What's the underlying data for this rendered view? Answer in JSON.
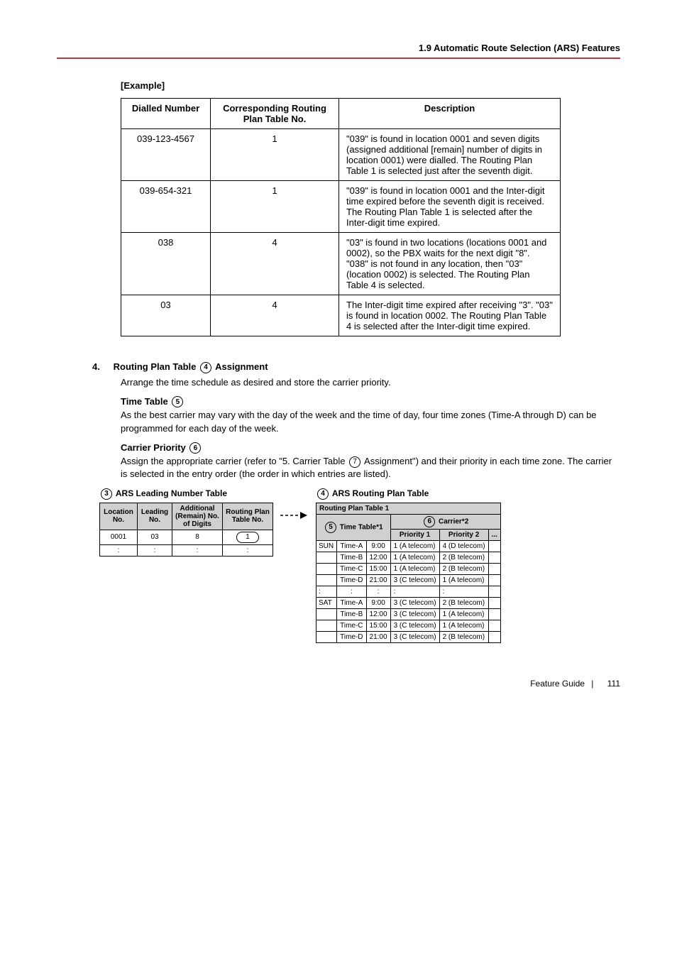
{
  "header": "1.9 Automatic Route Selection (ARS) Features",
  "example_label": "[Example]",
  "example_table": {
    "headers": [
      "Dialled Number",
      "Corresponding Routing Plan Table No.",
      "Description"
    ],
    "rows": [
      {
        "c1": "039-123-4567",
        "c2": "1",
        "c3": "\"039\" is found in location 0001 and seven digits (assigned additional [remain] number of digits in location 0001) were dialled. The Routing Plan Table 1 is selected just after the seventh digit."
      },
      {
        "c1": "039-654-321",
        "c2": "1",
        "c3": "\"039\" is found in location 0001 and the Inter-digit time expired before the seventh digit is received. The Routing Plan Table 1 is selected after the Inter-digit time expired."
      },
      {
        "c1": "038",
        "c2": "4",
        "c3": "\"03\" is found in two locations (locations 0001 and 0002), so the PBX waits for the next digit \"8\". \"038\" is not found in any location, then \"03\" (location 0002) is selected. The Routing Plan Table 4 is selected."
      },
      {
        "c1": "03",
        "c2": "4",
        "c3": "The Inter-digit time expired after receiving \"3\". \"03\" is found in location 0002. The Routing Plan Table 4 is selected after the Inter-digit time expired."
      }
    ]
  },
  "step4": {
    "num": "4.",
    "title_a": "Routing Plan Table",
    "title_b": "Assignment",
    "circle4": "4",
    "para1": "Arrange the time schedule as desired and store the carrier priority.",
    "sub1_a": "Time Table",
    "circle5": "5",
    "para2": "As the best carrier may vary with the day of the week and the time of day, four time zones (Time-A through D) can be programmed for each day of the week.",
    "sub2_a": "Carrier Priority",
    "circle6": "6",
    "para3_a": "Assign the appropriate carrier (refer to \"5. Carrier Table",
    "circle7": "7",
    "para3_b": "Assignment\") and their priority in each time zone. The carrier is selected in the entry order (the order in which entries are listed)."
  },
  "leading_table": {
    "circle3": "3",
    "title": "ARS Leading Number Table",
    "headers": [
      "Location No.",
      "Leading No.",
      "Additional (Remain) No. of Digits",
      "Routing Plan Table No."
    ],
    "row": {
      "c1": "0001",
      "c2": "03",
      "c3": "8",
      "c4": "1"
    },
    "dots": ":"
  },
  "routing_plan": {
    "circle4": "4",
    "title": "ARS Routing Plan Table",
    "subtitle": "Routing Plan Table 1",
    "time_label": "Time Table*1",
    "circle5": "5",
    "carrier_label": "Carrier*2",
    "circle6": "6",
    "p1": "Priority 1",
    "p2": "Priority 2",
    "dots3": "...",
    "rows": [
      {
        "day": "SUN",
        "slot": "Time-A",
        "time": "9:00",
        "pr1": "1 (A telecom)",
        "pr2": "4 (D telecom)"
      },
      {
        "day": "",
        "slot": "Time-B",
        "time": "12:00",
        "pr1": "1 (A telecom)",
        "pr2": "2 (B telecom)"
      },
      {
        "day": "",
        "slot": "Time-C",
        "time": "15:00",
        "pr1": "1 (A telecom)",
        "pr2": "2 (B telecom)"
      },
      {
        "day": "",
        "slot": "Time-D",
        "time": "21:00",
        "pr1": "3 (C telecom)",
        "pr2": "1 (A telecom)"
      },
      {
        "day": ":",
        "slot": ":",
        "time": ":",
        "pr1": ":",
        "pr2": ":"
      },
      {
        "day": "SAT",
        "slot": "Time-A",
        "time": "9:00",
        "pr1": "3 (C telecom)",
        "pr2": "2 (B telecom)"
      },
      {
        "day": "",
        "slot": "Time-B",
        "time": "12:00",
        "pr1": "3 (C telecom)",
        "pr2": "1 (A telecom)"
      },
      {
        "day": "",
        "slot": "Time-C",
        "time": "15:00",
        "pr1": "3 (C telecom)",
        "pr2": "1 (A telecom)"
      },
      {
        "day": "",
        "slot": "Time-D",
        "time": "21:00",
        "pr1": "3 (C telecom)",
        "pr2": "2 (B telecom)"
      }
    ]
  },
  "footer": {
    "label": "Feature Guide",
    "page": "111"
  }
}
